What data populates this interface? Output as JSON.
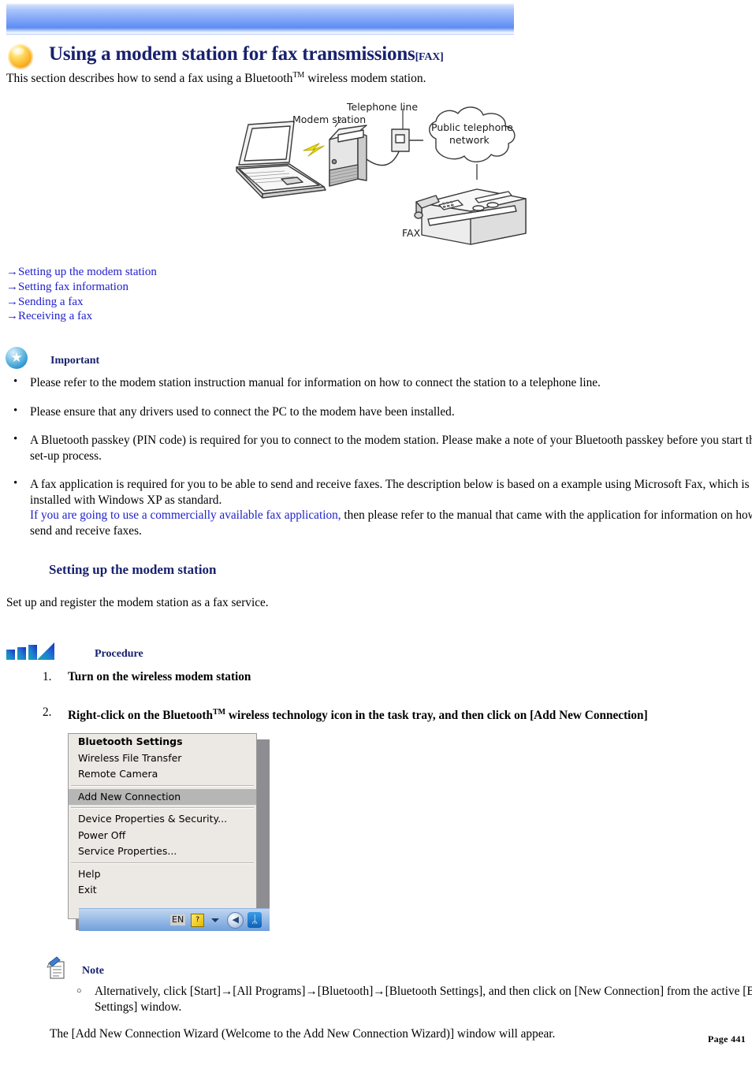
{
  "document": {
    "title": "Using a modem station for fax transmissions",
    "title_suffix": "[FAX]",
    "intro": "This section describes how to send a fax using a Bluetooth",
    "intro_tm": "TM",
    "intro_tail": " wireless modem station.",
    "page_number": "Page 441",
    "icons": {
      "title_orb": "orange-orb-icon",
      "important": "important-star-icon",
      "procedure": "procedure-arrow-icon",
      "note": "note-pencil-icon"
    },
    "colors": {
      "heading": "#18216e",
      "link": "#2222cc",
      "banner_top": "#cfdffd",
      "banner_bottom": "#5c8cf4",
      "menu_bg": "#ece9e4",
      "menu_highlight": "#b6b6b6"
    }
  },
  "diagram": {
    "alt": "Bluetooth modem station fax connection diagram",
    "labels": {
      "modem_station": "Modem station",
      "telephone_line": "Telephone line",
      "public_network_line1": "Public telephone",
      "public_network_line2": "network",
      "fax": "FAX"
    }
  },
  "links": [
    {
      "arrow": "→",
      "label": "Setting up the modem station"
    },
    {
      "arrow": "→",
      "label": "Setting fax information"
    },
    {
      "arrow": "→",
      "label": "Sending a fax"
    },
    {
      "arrow": "→",
      "label": "Receiving a fax"
    }
  ],
  "important": {
    "label": "Important",
    "items": [
      {
        "text": "Please refer to the modem station instruction manual for information on how to connect the station to a telephone line."
      },
      {
        "text": "Please ensure that any drivers used to connect the PC to the modem have been installed."
      },
      {
        "text": "A Bluetooth passkey (PIN code) is required for you to connect to the modem station. Please make a note of your Bluetooth passkey before you start the set-up process."
      },
      {
        "text": "A fax application is required for you to be able to send and receive faxes. The description below is based on a example using Microsoft Fax, which is installed with Windows XP as standard.",
        "link_text": "If you are going to use a commercially available fax application,",
        "tail_text": " then please refer to the manual that came with the application for information on how to send and receive faxes."
      }
    ]
  },
  "section": {
    "heading": "Setting up the modem station",
    "intro": "Set up and register the modem station as a fax service."
  },
  "procedure": {
    "label": "Procedure",
    "steps": [
      {
        "num": "1.",
        "text": "Turn on the wireless modem station"
      },
      {
        "num": "2.",
        "text_before_tm": "Right-click on the Bluetooth",
        "tm": "TM",
        "text_after_tm": " wireless technology icon in the task tray, and then click on [Add New Connection]"
      }
    ]
  },
  "context_menu": {
    "groups": [
      {
        "items": [
          {
            "label": "Bluetooth Settings",
            "bold": true,
            "selected": false
          },
          {
            "label": "Wireless File Transfer",
            "bold": false,
            "selected": false
          },
          {
            "label": "Remote Camera",
            "bold": false,
            "selected": false
          }
        ]
      },
      {
        "items": [
          {
            "label": "Add New Connection",
            "bold": false,
            "selected": true
          }
        ]
      },
      {
        "items": [
          {
            "label": "Device Properties & Security...",
            "bold": false,
            "selected": false
          },
          {
            "label": "Power Off",
            "bold": false,
            "selected": false
          },
          {
            "label": "Service Properties...",
            "bold": false,
            "selected": false
          }
        ]
      },
      {
        "items": [
          {
            "label": "Help",
            "bold": false,
            "selected": false
          },
          {
            "label": "Exit",
            "bold": false,
            "selected": false
          }
        ]
      }
    ],
    "tray": {
      "language": "EN",
      "help_icon": "help-balloon-icon",
      "overflow_arrow": "chevron-down-icon",
      "circle_icon": "volume-icon",
      "bluetooth_icon": "bluetooth-icon",
      "bluetooth_glyph": "ᛦ"
    }
  },
  "note": {
    "label": "Note",
    "items": [
      {
        "text": "Alternatively, click [Start]→[All Programs]→[Bluetooth]→[Bluetooth Settings], and then click on [New Connection] from the active [Bluetooth Settings] window."
      }
    ]
  },
  "closing": {
    "text": "The [Add New Connection Wizard (Welcome to the Add New Connection Wizard)] window will appear."
  }
}
